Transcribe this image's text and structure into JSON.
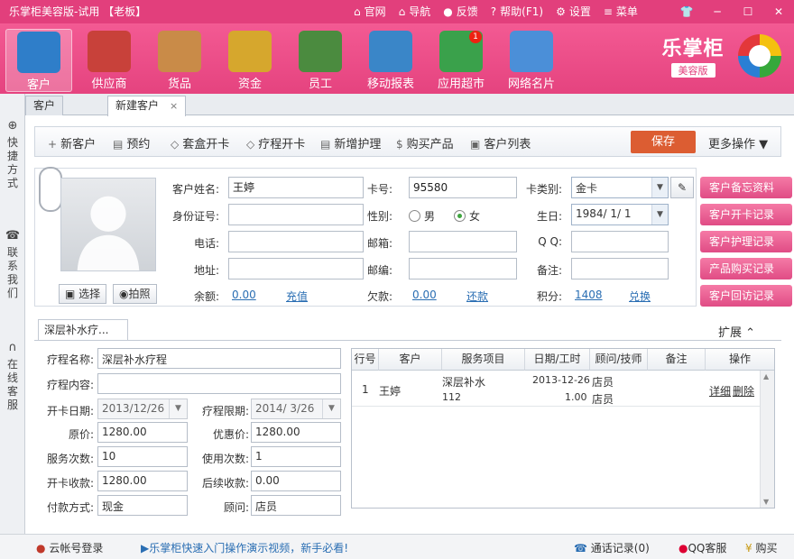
{
  "window": {
    "title": "乐掌柜美容版-试用 【老板】",
    "links": [
      "官网",
      "导航",
      "反馈",
      "帮助(F1)",
      "设置",
      "菜单"
    ]
  },
  "toolbar": {
    "items": [
      {
        "label": "客户",
        "icon": "customer-icon",
        "color": "#2f7ec9"
      },
      {
        "label": "供应商",
        "icon": "supplier-bus-icon",
        "color": "#c8413a"
      },
      {
        "label": "货品",
        "icon": "goods-icon",
        "color": "#c98b48"
      },
      {
        "label": "资金",
        "icon": "money-bag-icon",
        "color": "#d6a72d"
      },
      {
        "label": "员工",
        "icon": "employee-icon",
        "color": "#4b8b3f"
      },
      {
        "label": "移动报表",
        "icon": "mobile-report-icon",
        "color": "#3a86c8"
      },
      {
        "label": "应用超市",
        "icon": "app-market-cart-icon",
        "color": "#3aa14b"
      },
      {
        "label": "网络名片",
        "icon": "business-card-icon",
        "color": "#4b8fd8"
      }
    ],
    "market_badge": "1",
    "logo_text": "乐掌柜",
    "logo_sub": "美容版"
  },
  "left_strip": {
    "items": [
      "快捷方式",
      "联系我们",
      "在线客服"
    ]
  },
  "tabs": [
    {
      "label": "客户"
    },
    {
      "label": "新建客户",
      "close": "×"
    }
  ],
  "actions": {
    "buttons": [
      {
        "label": "新客户",
        "glyph": "+"
      },
      {
        "label": "预约",
        "glyph": "▤"
      },
      {
        "label": "套盒开卡",
        "glyph": "◇"
      },
      {
        "label": "疗程开卡",
        "glyph": "◇"
      },
      {
        "label": "新增护理",
        "glyph": "▤"
      },
      {
        "label": "购买产品",
        "glyph": "$"
      },
      {
        "label": "客户列表",
        "glyph": "▣"
      }
    ],
    "save": "保存",
    "more": "更多操作"
  },
  "customer": {
    "photo_buttons": {
      "choose": "选择",
      "shoot": "拍照"
    },
    "labels": {
      "name": "客户姓名:",
      "card_no": "卡号:",
      "card_type": "卡类别:",
      "id_no": "身份证号:",
      "gender": "性别:",
      "birthday": "生日:",
      "phone": "电话:",
      "email": "邮箱:",
      "qq": "Q Q:",
      "address": "地址:",
      "zip": "邮编:",
      "note": "备注:",
      "balance": "余额:",
      "debt": "欠款:",
      "points": "积分:"
    },
    "values": {
      "name": "王婷",
      "card_no": "95580",
      "card_type": "金卡",
      "birthday": "1984/ 1/ 1",
      "balance": "0.00",
      "debt": "0.00",
      "points": "1408"
    },
    "gender_options": {
      "male": "男",
      "female": "女",
      "selected": "女"
    },
    "links": {
      "recharge": "充值",
      "repay": "还款",
      "redeem": "兑换"
    }
  },
  "right_buttons": [
    "客户备忘资料",
    "客户开卡记录",
    "客户护理记录",
    "产品购买记录",
    "客户回访记录"
  ],
  "treatment": {
    "tab": "深层补水疗...",
    "expand": "扩展",
    "labels": {
      "name": "疗程名称:",
      "content": "疗程内容:",
      "open_date": "开卡日期:",
      "period": "疗程限期:",
      "price": "原价:",
      "discount": "优惠价:",
      "times": "服务次数:",
      "used": "使用次数:",
      "open_fee": "开卡收款:",
      "later_fee": "后续收款:",
      "pay": "付款方式:",
      "advisor": "顾问:"
    },
    "values": {
      "name": "深层补水疗程",
      "content": "",
      "open_date": "2013/12/26",
      "period": "2014/ 3/26",
      "price": "1280.00",
      "discount": "1280.00",
      "times": "10",
      "used": "1",
      "open_fee": "1280.00",
      "later_fee": "0.00",
      "pay": "现金",
      "advisor": "店员"
    }
  },
  "grid": {
    "columns": [
      "行号",
      "客户",
      "服务项目",
      "日期/工时",
      "顾问/技师",
      "备注",
      "操作"
    ],
    "rows": [
      {
        "no": "1",
        "customer": "王婷",
        "item": "深层补水",
        "item_sub": "112",
        "date": "2013-12-26",
        "hours": "1.00",
        "advisor": "店员",
        "tech": "店员",
        "note": "",
        "detail": "详细",
        "delete": "删除"
      }
    ]
  },
  "status": {
    "login": "云帐号登录",
    "tip": "乐掌柜快速入门操作演示视频，新手必看!",
    "calls": "通话记录(0)",
    "qq": "QQ客服",
    "buy": "购买"
  }
}
